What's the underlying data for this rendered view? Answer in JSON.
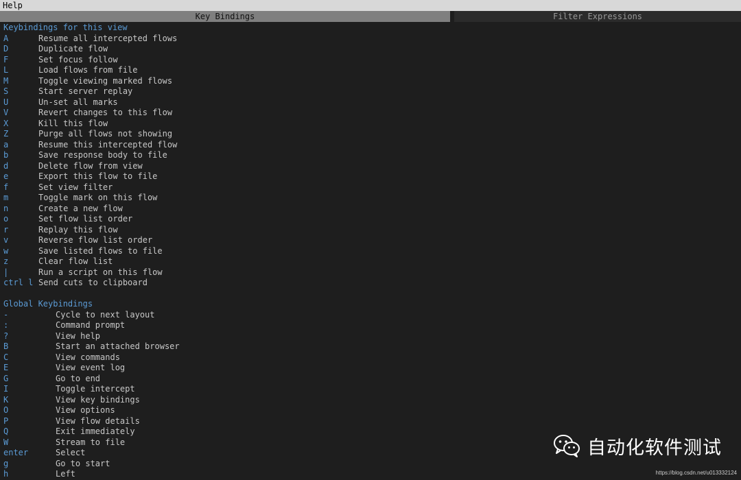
{
  "window": {
    "title": "Help"
  },
  "tabs": {
    "active": "Key Bindings",
    "inactive": "Filter Expressions"
  },
  "view_section": {
    "heading": "Keybindings for this view",
    "bindings": [
      {
        "key": "A",
        "desc": "Resume all intercepted flows"
      },
      {
        "key": "D",
        "desc": "Duplicate flow"
      },
      {
        "key": "F",
        "desc": "Set focus follow"
      },
      {
        "key": "L",
        "desc": "Load flows from file"
      },
      {
        "key": "M",
        "desc": "Toggle viewing marked flows"
      },
      {
        "key": "S",
        "desc": "Start server replay"
      },
      {
        "key": "U",
        "desc": "Un-set all marks"
      },
      {
        "key": "V",
        "desc": "Revert changes to this flow"
      },
      {
        "key": "X",
        "desc": "Kill this flow"
      },
      {
        "key": "Z",
        "desc": "Purge all flows not showing"
      },
      {
        "key": "a",
        "desc": "Resume this intercepted flow"
      },
      {
        "key": "b",
        "desc": "Save response body to file"
      },
      {
        "key": "d",
        "desc": "Delete flow from view"
      },
      {
        "key": "e",
        "desc": "Export this flow to file"
      },
      {
        "key": "f",
        "desc": "Set view filter"
      },
      {
        "key": "m",
        "desc": "Toggle mark on this flow"
      },
      {
        "key": "n",
        "desc": "Create a new flow"
      },
      {
        "key": "o",
        "desc": "Set flow list order"
      },
      {
        "key": "r",
        "desc": "Replay this flow"
      },
      {
        "key": "v",
        "desc": "Reverse flow list order"
      },
      {
        "key": "w",
        "desc": "Save listed flows to file"
      },
      {
        "key": "z",
        "desc": "Clear flow list"
      },
      {
        "key": "|",
        "desc": "Run a script on this flow"
      },
      {
        "key": "ctrl l",
        "desc": "Send cuts to clipboard"
      }
    ]
  },
  "global_section": {
    "heading": "Global Keybindings",
    "bindings": [
      {
        "key": "-",
        "desc": "Cycle to next layout"
      },
      {
        "key": ":",
        "desc": "Command prompt"
      },
      {
        "key": "?",
        "desc": "View help"
      },
      {
        "key": "B",
        "desc": "Start an attached browser"
      },
      {
        "key": "C",
        "desc": "View commands"
      },
      {
        "key": "E",
        "desc": "View event log"
      },
      {
        "key": "G",
        "desc": "Go to end"
      },
      {
        "key": "I",
        "desc": "Toggle intercept"
      },
      {
        "key": "K",
        "desc": "View key bindings"
      },
      {
        "key": "O",
        "desc": "View options"
      },
      {
        "key": "P",
        "desc": "View flow details"
      },
      {
        "key": "Q",
        "desc": "Exit immediately"
      },
      {
        "key": "W",
        "desc": "Stream to file"
      },
      {
        "key": "enter",
        "desc": "Select"
      },
      {
        "key": "g",
        "desc": "Go to start"
      },
      {
        "key": "h",
        "desc": "Left"
      }
    ]
  },
  "watermark": {
    "icon": "wechat-icon",
    "text": "自动化软件测试",
    "url": "https://blog.csdn.net/u013332124"
  },
  "colors": {
    "background": "#1e1e1e",
    "key": "#5b9bd5",
    "text": "#c8c8c8",
    "title_bar": "#d8d8d8",
    "active_tab": "#7f7f7f",
    "inactive_tab": "#2b2b2b"
  }
}
